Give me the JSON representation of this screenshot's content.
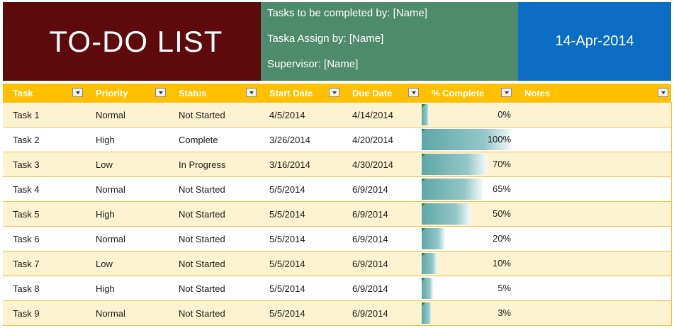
{
  "header": {
    "title": "TO-DO LIST",
    "completed_by": "Tasks to be completed by: [Name]",
    "assigned_by": "Taska Assign by: [Name]",
    "supervisor": "Supervisor: [Name]",
    "date": "14-Apr-2014"
  },
  "colors": {
    "title_bg": "#5c0a0c",
    "info_bg": "#4e8a6c",
    "date_bg": "#0b6dc4",
    "table_header_bg": "#ffc000",
    "row_band": "#fdf3d1",
    "databar": "#5ea6a8"
  },
  "columns": [
    "Task",
    "Priority",
    "Status",
    "Start Date",
    "Due Date",
    "% Complete",
    "Notes"
  ],
  "rows": [
    {
      "task": "Task 1",
      "priority": "Normal",
      "status": "Not Started",
      "start": "4/5/2014",
      "due": "4/14/2014",
      "pct": "0%",
      "pct_value": 0,
      "notes": ""
    },
    {
      "task": "Task 2",
      "priority": "High",
      "status": "Complete",
      "start": "3/26/2014",
      "due": "4/20/2014",
      "pct": "100%",
      "pct_value": 100,
      "notes": ""
    },
    {
      "task": "Task 3",
      "priority": "Low",
      "status": "In Progress",
      "start": "3/16/2014",
      "due": "4/30/2014",
      "pct": "70%",
      "pct_value": 70,
      "notes": ""
    },
    {
      "task": "Task 4",
      "priority": "Normal",
      "status": "Not Started",
      "start": "5/5/2014",
      "due": "6/9/2014",
      "pct": "65%",
      "pct_value": 65,
      "notes": ""
    },
    {
      "task": "Task 5",
      "priority": "High",
      "status": "Not Started",
      "start": "5/5/2014",
      "due": "6/9/2014",
      "pct": "50%",
      "pct_value": 50,
      "notes": ""
    },
    {
      "task": "Task 6",
      "priority": "Normal",
      "status": "Not Started",
      "start": "5/5/2014",
      "due": "6/9/2014",
      "pct": "20%",
      "pct_value": 20,
      "notes": ""
    },
    {
      "task": "Task 7",
      "priority": "Low",
      "status": "Not Started",
      "start": "5/5/2014",
      "due": "6/9/2014",
      "pct": "10%",
      "pct_value": 10,
      "notes": ""
    },
    {
      "task": "Task 8",
      "priority": "High",
      "status": "Not Started",
      "start": "5/5/2014",
      "due": "6/9/2014",
      "pct": "5%",
      "pct_value": 5,
      "notes": ""
    },
    {
      "task": "Task 9",
      "priority": "Normal",
      "status": "Not Started",
      "start": "5/5/2014",
      "due": "6/9/2014",
      "pct": "3%",
      "pct_value": 3,
      "notes": ""
    }
  ]
}
